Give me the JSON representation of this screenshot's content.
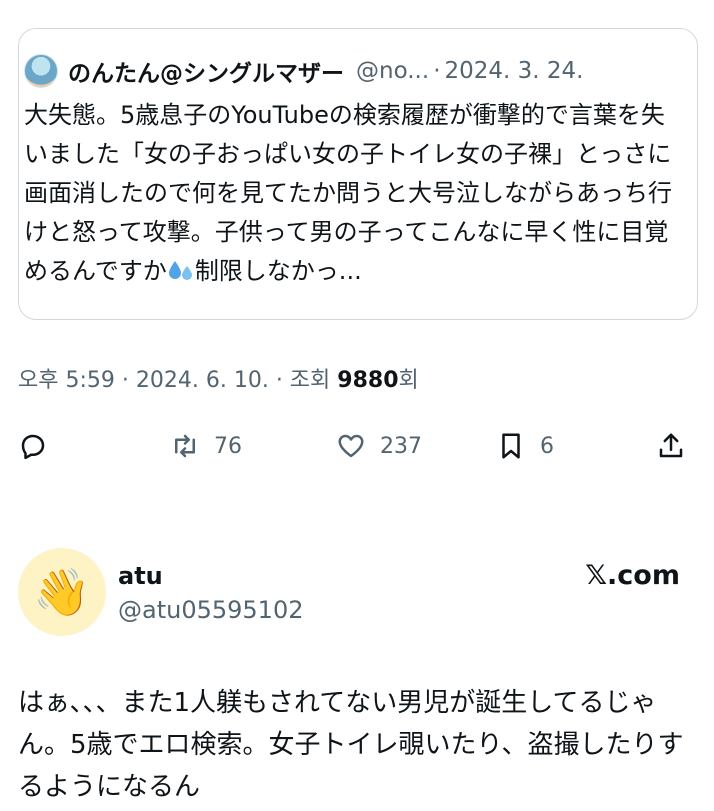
{
  "quoted_tweet": {
    "author_name": "のんたん@シングルマザー",
    "handle": "@no...",
    "separator": "·",
    "date": "2024. 3. 24.",
    "text": "大失態。5歳息子のYouTubeの検索履歴が衝撃的で言葉を失いました「女の子おっぱい女の子トイレ女の子裸」とっさに画面消したので何を見てたか問うと大号泣しながらあっち行けと怒って攻撃。子供って男の子ってこんなに早く性に目覚めるんですか",
    "text_tail": "制限しなかっ...",
    "emoji_icon": "sweat-droplets-icon"
  },
  "meta": {
    "time": "오후 5:59",
    "date": "· 2024. 6. 10. · 조회",
    "views": "9880",
    "views_suffix": "회"
  },
  "actions": {
    "reply_icon": "reply-icon",
    "retweet_icon": "retweet-icon",
    "retweets": "76",
    "like_icon": "heart-icon",
    "likes": "237",
    "bookmark_icon": "bookmark-icon",
    "bookmarks": "6",
    "share_icon": "share-icon"
  },
  "reply_tweet": {
    "avatar_emoji": "👋",
    "name": "atu",
    "handle": "@atu05595102",
    "source": "𝕏.com",
    "text": "はぁ、、、また1人躾もされてない男児が誕生してるじゃん。5歳でエロ検索。女子トイレ覗いたり、盗撮したりするようになるん"
  },
  "colors": {
    "text_primary": "#0f1419",
    "text_secondary": "#536471",
    "border": "#cfd9de",
    "avatar_bg": "#fdf3c4"
  }
}
